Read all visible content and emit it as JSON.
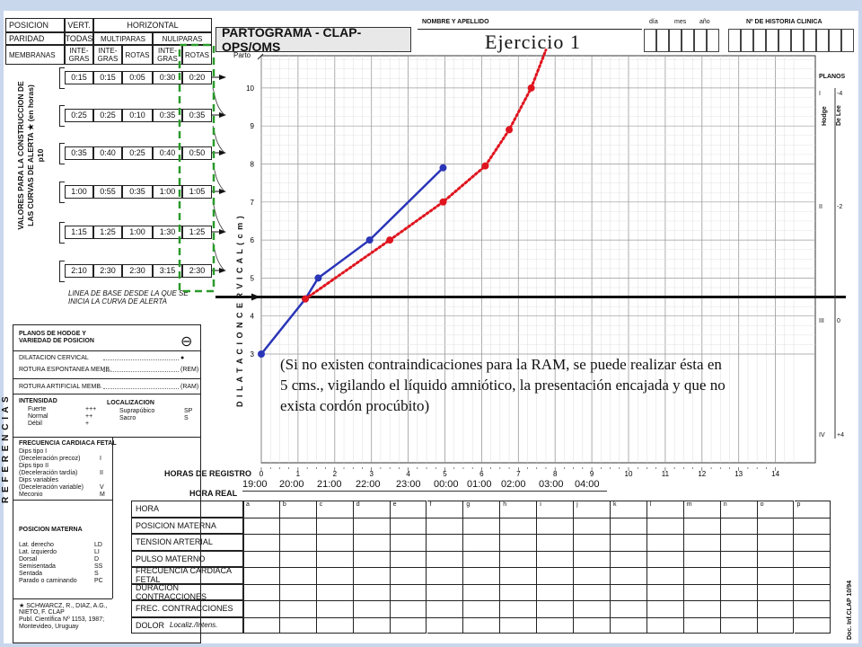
{
  "header": {
    "table_row1": [
      "POSICION",
      "VERT.",
      "HORIZONTAL"
    ],
    "table_row2": [
      "PARIDAD",
      "TODAS",
      "MULTIPARAS",
      "NULIPARAS"
    ],
    "table_row3": [
      "MEMBRANAS",
      "INTE-\nGRAS",
      "INTE-\nGRAS",
      "ROTAS",
      "INTE-\nGRAS",
      "ROTAS"
    ],
    "form_title": "PARTOGRAMA  - CLAP-OPS/OMS",
    "nombre_label": "NOMBRE Y APELLIDO",
    "date_labels": [
      "día",
      "mes",
      "año"
    ],
    "historia_label": "Nº DE HISTORIA CLINICA",
    "exercise_title": "Ejercicio 1"
  },
  "alert_table": {
    "vertical_caption": "VALORES PARA LA CONSTRUCCION DE LAS CURVAS DE ALERTA ★ (en horas) p10",
    "rows": [
      [
        "0:15",
        "0:15",
        "0:05",
        "0:30",
        "0:20"
      ],
      [
        "0:25",
        "0:25",
        "0:10",
        "0:35",
        "0:35"
      ],
      [
        "0:35",
        "0:40",
        "0:25",
        "0:40",
        "0:50"
      ],
      [
        "1:00",
        "0:55",
        "0:35",
        "1:00",
        "1:05"
      ],
      [
        "1:15",
        "1:25",
        "1:00",
        "1:30",
        "1:25"
      ],
      [
        "2:10",
        "2:30",
        "2:30",
        "3:15",
        "2:30"
      ]
    ],
    "baseline_text": "LINEA DE BASE DESDE LA QUE SE INICIA LA CURVA DE ALERTA",
    "parto_label": "Parto"
  },
  "references": {
    "vertical_title": "R E F E R E N C I A S",
    "hodge_lines": [
      "PLANOS DE HODGE Y",
      "VARIEDAD DE POSICION"
    ],
    "hodge_symbol": "⊖",
    "items": [
      {
        "label": "DILATACION CERVICAL",
        "code": "●"
      },
      {
        "label": "ROTURA ESPONTANEA MEMB.",
        "code": "(REM)"
      },
      {
        "label": "ROTURA ARTIFICIAL MEMB.",
        "code": "(RAM)"
      }
    ],
    "intensidad_title": "INTENSIDAD",
    "intensidad": [
      [
        "Fuerte",
        "+++"
      ],
      [
        "Normal",
        "++"
      ],
      [
        "Débil",
        "+"
      ]
    ],
    "localizacion_title": "LOCALIZACION",
    "localizacion": [
      [
        "Suprapúbico",
        "SP"
      ],
      [
        "Sacro",
        "S"
      ]
    ],
    "fcf_title": "FRECUENCIA CARDIACA FETAL",
    "fcf_items": [
      [
        "Dips tipo I",
        ""
      ],
      [
        "(Deceleración precoz)",
        "I"
      ],
      [
        "Dips tipo II",
        ""
      ],
      [
        "(Deceleración tardía)",
        "II"
      ],
      [
        "Dips variables",
        ""
      ],
      [
        "(Deceleración variable)",
        "V"
      ],
      [
        "Meconio",
        "M"
      ]
    ],
    "posicion_title": "POSICION MATERNA",
    "posicion_items": [
      [
        "Lat. derecho",
        "LD"
      ],
      [
        "Lat. izquierdo",
        "LI"
      ],
      [
        "Dorsal",
        "D"
      ],
      [
        "Semisentada",
        "SS"
      ],
      [
        "Sentada",
        "S"
      ],
      [
        "Parado o caminando",
        "PC"
      ]
    ],
    "citation": [
      "★ SCHWARCZ, R., DIAZ, A.G.,",
      "NIETO, F. CLAP",
      "Publ. Científica Nº 1153, 1987;",
      "Montevideo, Uruguay"
    ]
  },
  "chart_data": {
    "type": "line",
    "ylabel": "D I L A T A C I O N   C E R V I C A L   ( c m )",
    "xlabel": "HORAS DE REGISTRO",
    "ylim": [
      2.7,
      11
    ],
    "xlim": [
      0,
      14.5
    ],
    "y_ticks": [
      3,
      4,
      5,
      6,
      7,
      8,
      9,
      10
    ],
    "x_ticks": [
      0,
      1,
      2,
      3,
      4,
      5,
      6,
      7,
      8,
      9,
      10,
      11,
      12,
      13,
      14
    ],
    "baseline_y": 4.5,
    "series": [
      {
        "name": "",
        "color": "#2a35b8",
        "style": "solid",
        "x": [
          0,
          1.2,
          1.55,
          2.95,
          4.95
        ],
        "y": [
          3,
          4.45,
          5,
          6,
          7.9
        ]
      },
      {
        "name": "",
        "color": "#e0141e",
        "style": "dotted",
        "x": [
          1.2,
          3.5,
          4.95,
          6.1,
          6.75,
          7.35,
          7.75
        ],
        "y": [
          4.45,
          6,
          7,
          7.95,
          8.9,
          10,
          11
        ]
      }
    ],
    "annotation": "(Si no existen contraindicaciones para la RAM, se puede realizar ésta en  5 cms., vigilando el líquido amniótico, la presentación encajada y que no exista cordón procúbito)"
  },
  "planos": {
    "title": "PLANOS",
    "hodge": "Hodge",
    "delee": "De Lee",
    "rows": [
      [
        "I",
        "-4"
      ],
      [
        "II",
        "-2"
      ],
      [
        "III",
        "0"
      ],
      [
        "IV",
        "+4"
      ]
    ]
  },
  "hora_real": {
    "label": "HORA REAL",
    "times": [
      "19:00",
      "20:00",
      "21:00",
      "22:00",
      "23:00",
      "00:00",
      "01:00",
      "02:00",
      "03:00",
      "04:00"
    ]
  },
  "bottom_table": {
    "rows": [
      "HORA",
      "POSICION MATERNA",
      "TENSION ARTERIAL",
      "PULSO MATERNO",
      "FRECUENCIA CARDIACA FETAL",
      "DURACION CONTRACCIONES",
      "FREC. CONTRACCIONES",
      "DOLOR"
    ],
    "dolor_sub": "Localiz./Intens.",
    "columns": [
      "a",
      "b",
      "c",
      "d",
      "e",
      "f",
      "g",
      "h",
      "i",
      "j",
      "k",
      "l",
      "m",
      "n",
      "o",
      "p"
    ]
  },
  "doc_code": "Doc. Inf.CLAP 10/94"
}
